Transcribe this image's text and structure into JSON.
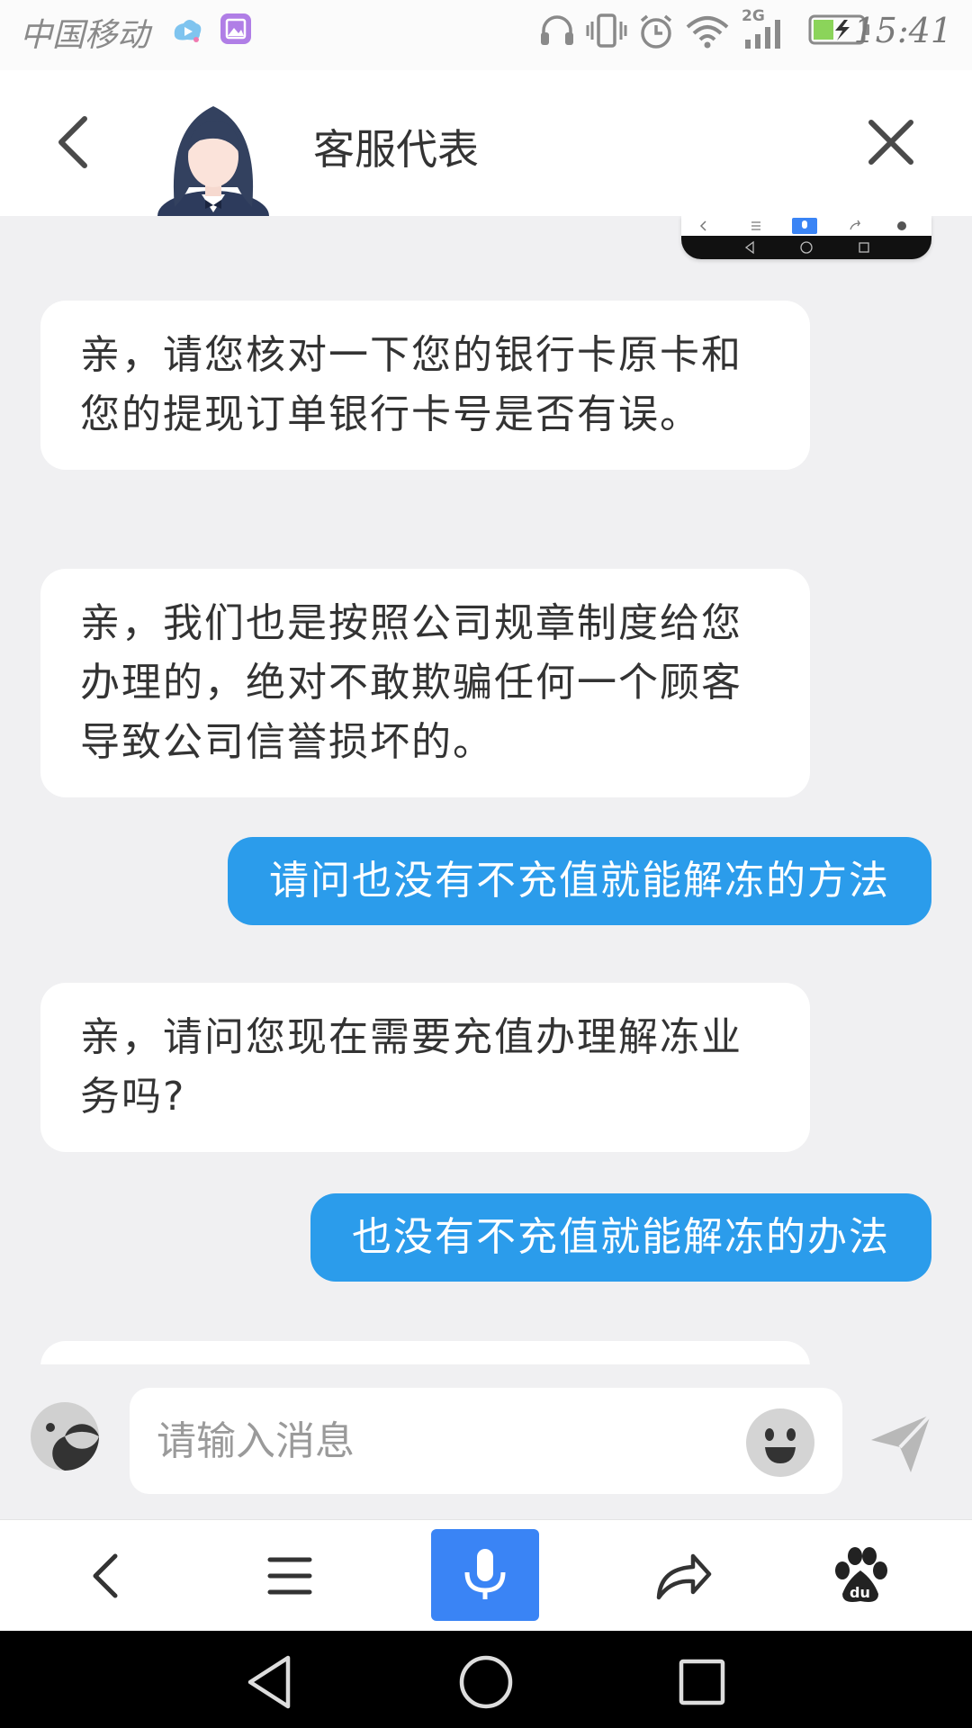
{
  "status_bar": {
    "carrier": "中国移动",
    "network": "2G",
    "time": "15:41"
  },
  "header": {
    "title": "客服代表"
  },
  "messages": [
    {
      "side": "in",
      "text": "亲，请您核对一下您的银行卡原卡和您的提现订单银行卡号是否有误。"
    },
    {
      "side": "in",
      "text": "亲，我们也是按照公司规章制度给您办理的，绝对不敢欺骗任何一个顾客导致公司信誉损坏的。"
    },
    {
      "side": "out",
      "text": "请问也没有不充值就能解冻的方法"
    },
    {
      "side": "in",
      "text": "亲，请问您现在需要充值办理解冻业务吗?"
    },
    {
      "side": "out",
      "text": "也没有不充值就能解冻的办法"
    }
  ],
  "input": {
    "placeholder": "请输入消息"
  },
  "colors": {
    "outgoing_bubble": "#2b9ceb",
    "mic_button": "#3a84f5",
    "background": "#f0f0f2"
  },
  "icons": {
    "header": [
      "back-arrow-icon",
      "avatar",
      "close-icon"
    ],
    "input": [
      "emoji-toggle-icon",
      "smiley-icon",
      "send-icon"
    ],
    "toolbar": [
      "back-icon",
      "menu-icon",
      "microphone-icon",
      "share-icon",
      "baidu-paw-icon"
    ],
    "navbar": [
      "nav-back-icon",
      "nav-home-icon",
      "nav-recents-icon"
    ]
  }
}
